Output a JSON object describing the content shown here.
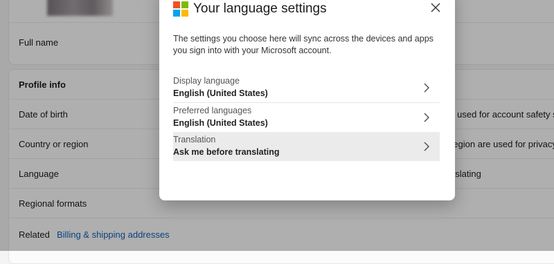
{
  "background": {
    "full_name_label": "Full name",
    "profile_info_heading": "Profile info",
    "date_of_birth_label": "Date of birth",
    "country_label": "Country or region",
    "language_label": "Language",
    "regional_formats_label": "Regional formats",
    "related_label": "Related",
    "billing_link": "Billing & shipping addresses",
    "dob_note": "s used for account safety s",
    "country_note": "region are used for privacy",
    "language_note": "nslating"
  },
  "dialog": {
    "title": "Your language settings",
    "description": "The settings you choose here will sync across the devices and apps you sign into with your Microsoft account.",
    "options": [
      {
        "label": "Display language",
        "value": "English (United States)"
      },
      {
        "label": "Preferred languages",
        "value": "English (United States)"
      },
      {
        "label": "Translation",
        "value": "Ask me before translating"
      }
    ]
  },
  "colors": {
    "ms_red": "#f25022",
    "ms_green": "#7fba00",
    "ms_blue": "#00a4ef",
    "ms_yellow": "#ffb900",
    "link": "#0f5fb8"
  },
  "icons": [
    "microsoft-logo-icon",
    "close-icon",
    "chevron-right-icon"
  ]
}
